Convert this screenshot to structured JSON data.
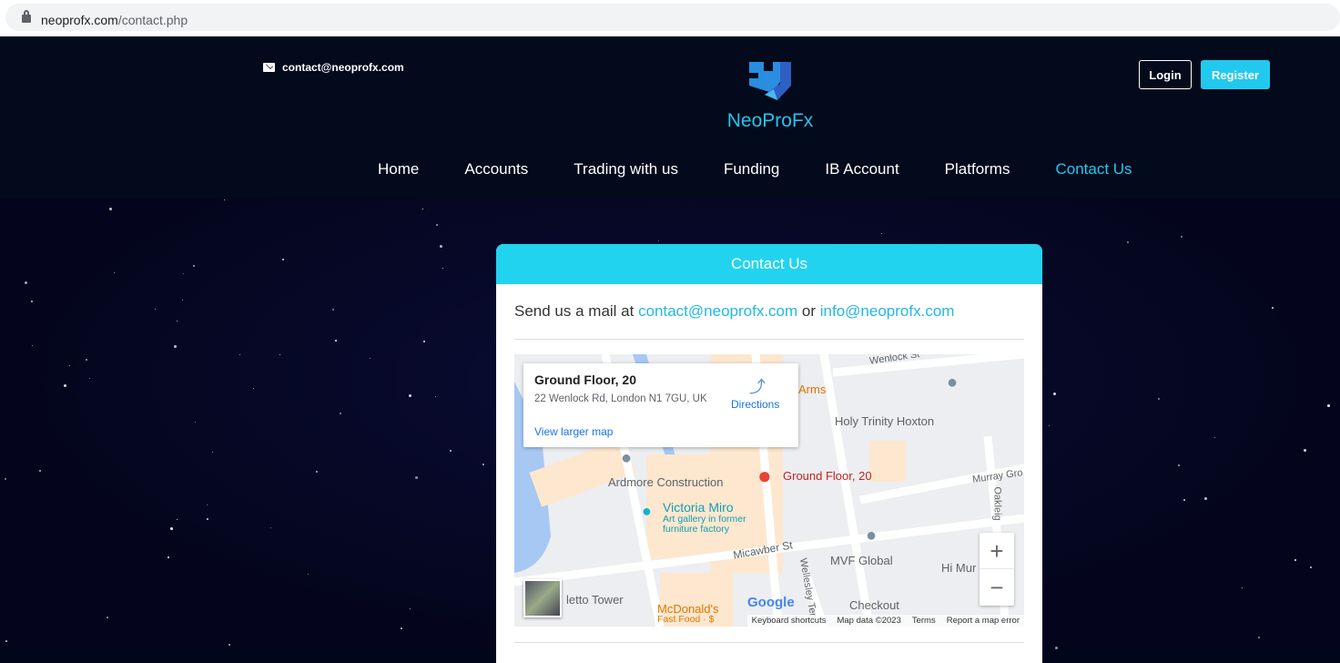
{
  "browser": {
    "url_host": "neoprofx.com",
    "url_path": "/contact.php"
  },
  "header": {
    "email": "contact@neoprofx.com",
    "brand": "NeoProFx",
    "login": "Login",
    "register": "Register"
  },
  "nav": [
    {
      "label": "Home"
    },
    {
      "label": "Accounts"
    },
    {
      "label": "Trading with us"
    },
    {
      "label": "Funding"
    },
    {
      "label": "IB Account"
    },
    {
      "label": "Platforms"
    },
    {
      "label": "Contact Us",
      "active": true
    }
  ],
  "contact": {
    "title": "Contact Us",
    "send_prefix": "Send us a mail at",
    "email1": "contact@neoprofx.com",
    "or": "or",
    "email2": "info@neoprofx.com"
  },
  "map": {
    "place_title": "Ground Floor, 20",
    "address": "22 Wenlock Rd, London N1 7GU, UK",
    "directions": "Directions",
    "view_larger": "View larger map",
    "labels": {
      "wenlock": "Wenlock St",
      "arms": "Arms",
      "holy": "Holy Trinity Hoxton",
      "ardmore": "Ardmore Construction",
      "pin": "Ground Floor, 20",
      "murray": "Murray Gro",
      "victoria": "Victoria Miro",
      "victoria_sub1": "Art gallery in former",
      "victoria_sub2": "furniture factory",
      "oakley": "Oakleig",
      "micawber": "Micawber St",
      "wellesley": "Wellesley Ter",
      "mvf": "MVF Global",
      "himur": "Hi Mur",
      "checkout": "Checkout",
      "letto": "letto Tower",
      "mcd": "McDonald's",
      "mcd_sub": "Fast Food · $"
    },
    "zoom_in": "+",
    "zoom_out": "−",
    "google": "Google",
    "attribution": {
      "shortcuts": "Keyboard shortcuts",
      "data": "Map data ©2023",
      "terms": "Terms",
      "report": "Report a map error"
    }
  }
}
